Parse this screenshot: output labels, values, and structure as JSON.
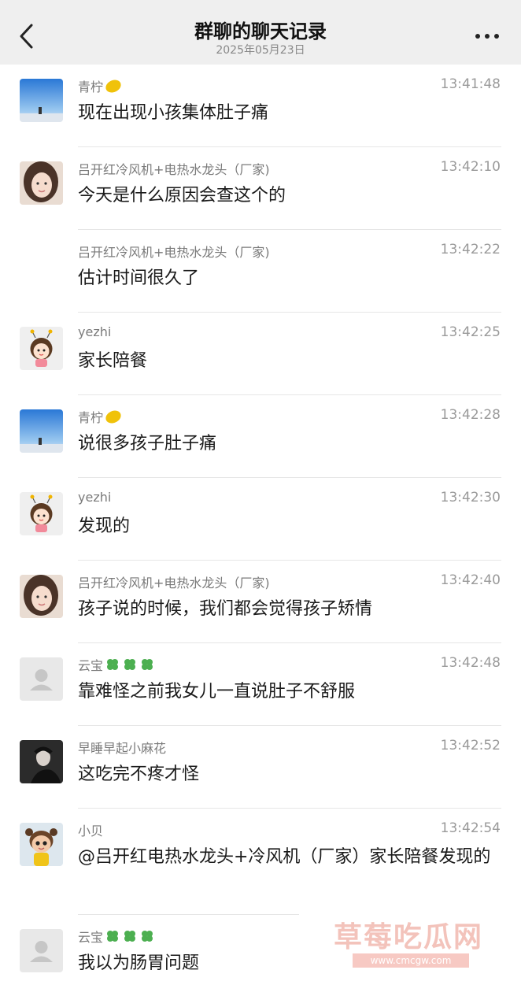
{
  "header": {
    "title": "群聊的聊天记录",
    "date": "2025年05月23日"
  },
  "messages": [
    {
      "avatar": "sky-photo-avatar",
      "sender": "青柠",
      "badge": "lemon",
      "time": "13:41:48",
      "text": "现在出现小孩集体肚子痛"
    },
    {
      "avatar": "woman-photo-avatar",
      "sender": "吕开红冷风机+电热水龙头（厂家)",
      "badge": "",
      "time": "13:42:10",
      "text": "今天是什么原因会查这个的"
    },
    {
      "avatar": "",
      "sender": "吕开红冷风机+电热水龙头（厂家)",
      "badge": "",
      "time": "13:42:22",
      "text": "估计时间很久了"
    },
    {
      "avatar": "cartoon-girl-avatar",
      "sender": "yezhi",
      "badge": "",
      "time": "13:42:25",
      "text": "家长陪餐"
    },
    {
      "avatar": "sky-photo-avatar",
      "sender": "青柠",
      "badge": "lemon",
      "time": "13:42:28",
      "text": "说很多孩子肚子痛"
    },
    {
      "avatar": "cartoon-girl-avatar",
      "sender": "yezhi",
      "badge": "",
      "time": "13:42:30",
      "text": "发现的"
    },
    {
      "avatar": "woman-photo-avatar",
      "sender": "吕开红冷风机+电热水龙头（厂家)",
      "badge": "",
      "time": "13:42:40",
      "text": "孩子说的时候，我们都会觉得孩子矫情"
    },
    {
      "avatar": "default-avatar",
      "sender": "云宝",
      "badge": "clovers",
      "time": "13:42:48",
      "text": "靠难怪之前我女儿一直说肚子不舒服"
    },
    {
      "avatar": "dark-photo-avatar",
      "sender": "早睡早起小麻花",
      "badge": "",
      "time": "13:42:52",
      "text": "这吃完不疼才怪"
    },
    {
      "avatar": "cartoon-3d-avatar",
      "sender": "小贝",
      "badge": "",
      "time": "13:42:54",
      "text": "@吕开红电热水龙头+冷风机（厂家）家长陪餐发现的"
    },
    {
      "avatar": "default-avatar",
      "sender": "云宝",
      "badge": "clovers",
      "time": "",
      "text": "我以为肠胃问题"
    }
  ],
  "watermark": {
    "text": "草莓吃瓜网",
    "url": "www.cmcgw.com"
  },
  "colors": {
    "header_bg": "#efefef",
    "name": "#7a7a7a",
    "time": "#9a9a9a",
    "divider": "#e6e6e6",
    "watermark": "#f3c3bb"
  }
}
